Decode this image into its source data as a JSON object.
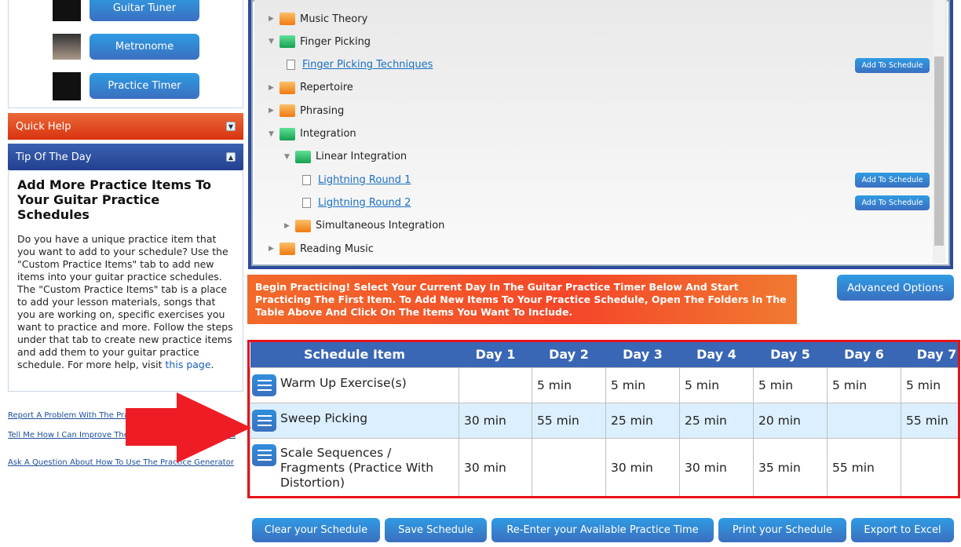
{
  "tools": [
    {
      "label": "Guitar Tuner",
      "icon": "guitar-fretboard-icon"
    },
    {
      "label": "Metronome",
      "icon": "metronome-icon"
    },
    {
      "label": "Practice Timer",
      "icon": "clock-icon"
    }
  ],
  "quick_help": {
    "title": "Quick Help",
    "colors": {
      "bg": "#e0471e"
    }
  },
  "tip": {
    "title": "Tip Of The Day",
    "heading": "Add More Practice Items To Your Guitar Practice Schedules",
    "body": "Do you have a unique practice item that you want to add to your schedule? Use the \"Custom Practice Items\" tab to add new items into your guitar practice schedules. The \"Custom Practice Items\" tab is a place to add your lesson materials, songs that you are working on, specific exercises you want to practice and more. Follow the steps under that tab to create new practice items and add them to your guitar practice schedule. For more help, visit ",
    "link": "this page",
    "end": "."
  },
  "links": [
    "Report A Problem With The Practice Generator",
    "Tell Me How I Can Improve The Practice Generator For You",
    "Ask A Question About How To Use The Practice Generator"
  ],
  "tree": [
    {
      "label": "Music Theory",
      "type": "folder",
      "open": false,
      "level": 0
    },
    {
      "label": "Finger Picking",
      "type": "folder",
      "open": true,
      "level": 0
    },
    {
      "label": "Finger Picking Techniques",
      "type": "item",
      "level": 1,
      "add": "Add To Schedule"
    },
    {
      "label": "Repertoire",
      "type": "folder",
      "open": false,
      "level": 0
    },
    {
      "label": "Phrasing",
      "type": "folder",
      "open": false,
      "level": 0
    },
    {
      "label": "Integration",
      "type": "folder",
      "open": true,
      "level": 0
    },
    {
      "label": "Linear Integration",
      "type": "folder",
      "open": true,
      "level": 1
    },
    {
      "label": "Lightning Round 1",
      "type": "item",
      "level": 2,
      "add": "Add To Schedule"
    },
    {
      "label": "Lightning Round 2",
      "type": "item",
      "level": 2,
      "add": "Add To Schedule"
    },
    {
      "label": "Simultaneous Integration",
      "type": "folder",
      "open": false,
      "level": 1
    },
    {
      "label": "Reading Music",
      "type": "folder",
      "open": false,
      "level": 0
    }
  ],
  "banner": "Begin Practicing! Select Your Current Day In The Guitar Practice Timer Below And Start Practicing The First Item. To Add New Items To Your Practice Schedule, Open The Folders In The Table Above And Click On The Items You Want To Include.",
  "advanced_options": "Advanced Options",
  "schedule": {
    "headers": [
      "Schedule Item",
      "Day 1",
      "Day 2",
      "Day 3",
      "Day 4",
      "Day 5",
      "Day 6",
      "Day 7"
    ],
    "rows": [
      {
        "item": "Warm Up Exercise(s)",
        "days": [
          "",
          "5 min",
          "5 min",
          "5 min",
          "5 min",
          "5 min",
          "5 min"
        ]
      },
      {
        "item": "Sweep Picking",
        "days": [
          "30 min",
          "55 min",
          "25 min",
          "25 min",
          "20 min",
          "",
          "55 min"
        ]
      },
      {
        "item": "Scale Sequences / Fragments (Practice With Distortion)",
        "days": [
          "30 min",
          "",
          "30 min",
          "30 min",
          "35 min",
          "55 min",
          ""
        ]
      }
    ]
  },
  "bottom_buttons": [
    "Clear your Schedule",
    "Save Schedule",
    "Re-Enter your Available Practice Time",
    "Print your Schedule",
    "Export to Excel"
  ],
  "colors": {
    "accent": "#3a67b5",
    "highlight": "#e8121a",
    "banner": "#f5472a"
  }
}
